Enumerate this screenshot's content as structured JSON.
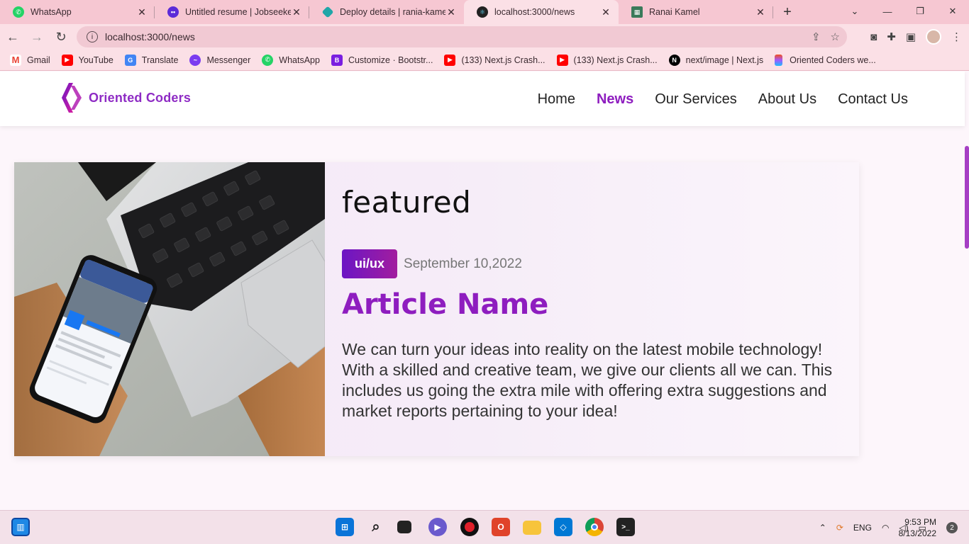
{
  "browser": {
    "tabs": [
      {
        "title": "WhatsApp",
        "icon": "whatsapp-icon",
        "color": "#25d366"
      },
      {
        "title": "Untitled resume | Jobseeker",
        "icon": "jobseeker-icon",
        "color": "#5b2bd8"
      },
      {
        "title": "Deploy details | rania-kamel-",
        "icon": "netlify-icon",
        "color": "#20a6a8"
      },
      {
        "title": "localhost:3000/news",
        "icon": "react-icon",
        "color": "#222222"
      },
      {
        "title": "Ranai Kamel",
        "icon": "site-icon",
        "color": "#3a7a5a"
      }
    ],
    "url": "localhost:3000/news",
    "bookmarks": [
      {
        "label": "Gmail",
        "icon": "gmail-icon",
        "color": "#ea4335"
      },
      {
        "label": "YouTube",
        "icon": "youtube-icon",
        "color": "#ff0000"
      },
      {
        "label": "Translate",
        "icon": "translate-icon",
        "color": "#4285f4"
      },
      {
        "label": "Messenger",
        "icon": "messenger-icon",
        "color": "#7b3cf0"
      },
      {
        "label": "WhatsApp",
        "icon": "whatsapp-icon",
        "color": "#25d366"
      },
      {
        "label": "Customize · Bootstr...",
        "icon": "bootstrap-icon",
        "color": "#7a1fe0"
      },
      {
        "label": "(133) Next.js Crash...",
        "icon": "youtube-icon",
        "color": "#ff0000"
      },
      {
        "label": "(133) Next.js Crash...",
        "icon": "youtube-icon",
        "color": "#ff0000"
      },
      {
        "label": "next/image | Next.js",
        "icon": "nextjs-icon",
        "color": "#000000"
      },
      {
        "label": "Oriented Coders we...",
        "icon": "figma-icon",
        "color": "#f24e1e"
      }
    ]
  },
  "site": {
    "logo_text": "Oriented Coders",
    "nav": [
      {
        "label": "Home",
        "active": false
      },
      {
        "label": "News",
        "active": true
      },
      {
        "label": "Our Services",
        "active": false
      },
      {
        "label": "About Us",
        "active": false
      },
      {
        "label": "Contact Us",
        "active": false
      }
    ],
    "accent": "#8e1dbf"
  },
  "featured": {
    "heading": "featured",
    "tag": "ui/ux",
    "date": "September 10,2022",
    "title": "Article Name",
    "description": "We can turn your ideas into reality on the latest mobile technology! With a skilled and creative team, we give our clients all we can. This includes us going the extra mile with offering extra suggestions and market reports pertaining to your idea!"
  },
  "taskbar": {
    "language": "ENG",
    "time": "9:53 PM",
    "date": "8/13/2022",
    "notifications": "2"
  }
}
